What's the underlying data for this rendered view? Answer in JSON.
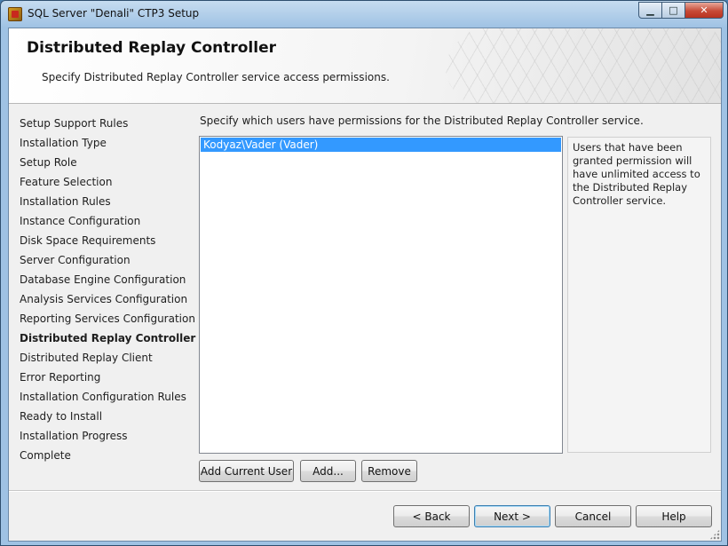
{
  "window": {
    "title": "SQL Server \"Denali\" CTP3 Setup",
    "caption_buttons": {
      "minimize": "▁",
      "maximize": "□",
      "close": "✕"
    }
  },
  "header": {
    "title": "Distributed Replay Controller",
    "subtitle": "Specify Distributed Replay Controller service access permissions."
  },
  "sidebar": {
    "items": [
      {
        "label": "Setup Support Rules",
        "active": false
      },
      {
        "label": "Installation Type",
        "active": false
      },
      {
        "label": "Setup Role",
        "active": false
      },
      {
        "label": "Feature Selection",
        "active": false
      },
      {
        "label": "Installation Rules",
        "active": false
      },
      {
        "label": "Instance Configuration",
        "active": false
      },
      {
        "label": "Disk Space Requirements",
        "active": false
      },
      {
        "label": "Server Configuration",
        "active": false
      },
      {
        "label": "Database Engine Configuration",
        "active": false
      },
      {
        "label": "Analysis Services Configuration",
        "active": false
      },
      {
        "label": "Reporting Services Configuration",
        "active": false
      },
      {
        "label": "Distributed Replay Controller",
        "active": true
      },
      {
        "label": "Distributed Replay Client",
        "active": false
      },
      {
        "label": "Error Reporting",
        "active": false
      },
      {
        "label": "Installation Configuration Rules",
        "active": false
      },
      {
        "label": "Ready to Install",
        "active": false
      },
      {
        "label": "Installation Progress",
        "active": false
      },
      {
        "label": "Complete",
        "active": false
      }
    ]
  },
  "main": {
    "instruction": "Specify which users have permissions for the Distributed Replay Controller service.",
    "users": [
      "Kodyaz\\Vader (Vader)"
    ],
    "info_text": "Users that have been granted permission will have unlimited access to the Distributed Replay Controller service.",
    "buttons": {
      "add_current_user": "Add Current User",
      "add": "Add...",
      "remove": "Remove"
    }
  },
  "footer": {
    "back": "< Back",
    "next": "Next >",
    "cancel": "Cancel",
    "help": "Help"
  },
  "colors": {
    "selection": "#3399ff",
    "window_frame": "#9fc2e4",
    "close_button": "#c74a36"
  },
  "icons": [
    "app-icon",
    "minimize-icon",
    "maximize-icon",
    "close-icon",
    "resize-grip-icon"
  ]
}
